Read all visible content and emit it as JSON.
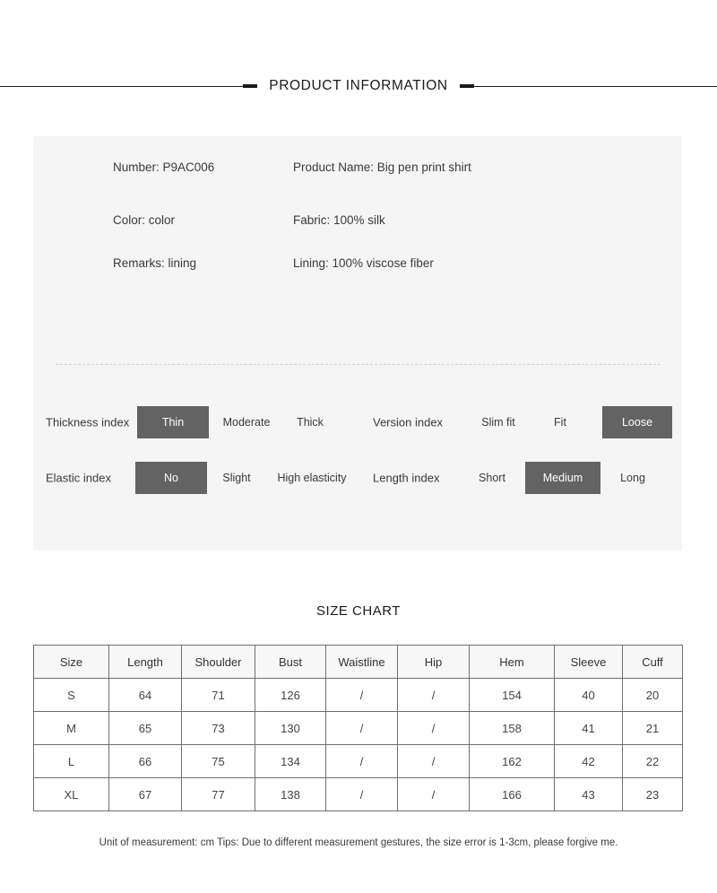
{
  "header": {
    "title": "PRODUCT INFORMATION"
  },
  "info": {
    "rows": [
      {
        "left": "Number: P9AC006",
        "right": "Product Name: Big pen print shirt"
      },
      {
        "left": "Color: color",
        "right": "Fabric: 100% silk"
      },
      {
        "left": "Remarks: lining",
        "right": "Lining: 100% viscose fiber"
      }
    ]
  },
  "indexes": {
    "thickness": {
      "label": "Thickness index",
      "options": [
        "Thin",
        "Moderate",
        "Thick"
      ],
      "selected": "Thin"
    },
    "version": {
      "label": "Version index",
      "options": [
        "Slim fit",
        "Fit",
        "Loose"
      ],
      "selected": "Loose"
    },
    "elastic": {
      "label": "Elastic index",
      "options": [
        "No",
        "Slight",
        "High elasticity"
      ],
      "selected": "No"
    },
    "length": {
      "label": "Length index",
      "options": [
        "Short",
        "Medium",
        "Long"
      ],
      "selected": "Medium"
    }
  },
  "size_chart": {
    "title": "SIZE CHART",
    "columns": [
      "Size",
      "Length",
      "Shoulder",
      "Bust",
      "Waistline",
      "Hip",
      "Hem",
      "Sleeve",
      "Cuff"
    ],
    "rows": [
      [
        "S",
        "64",
        "71",
        "126",
        "/",
        "/",
        "154",
        "40",
        "20"
      ],
      [
        "M",
        "65",
        "73",
        "130",
        "/",
        "/",
        "158",
        "41",
        "21"
      ],
      [
        "L",
        "66",
        "75",
        "134",
        "/",
        "/",
        "162",
        "42",
        "22"
      ],
      [
        "XL",
        "67",
        "77",
        "138",
        "/",
        "/",
        "166",
        "43",
        "23"
      ]
    ],
    "footnote": "Unit of measurement: cm Tips: Due to different measurement gestures, the size error is 1-3cm, please forgive me."
  },
  "colors": {
    "selected_pill_bg": "#636363",
    "card_bg": "#f5f5f5",
    "table_header_bg": "#f7f7f7",
    "rule": "#1a1a1a"
  }
}
